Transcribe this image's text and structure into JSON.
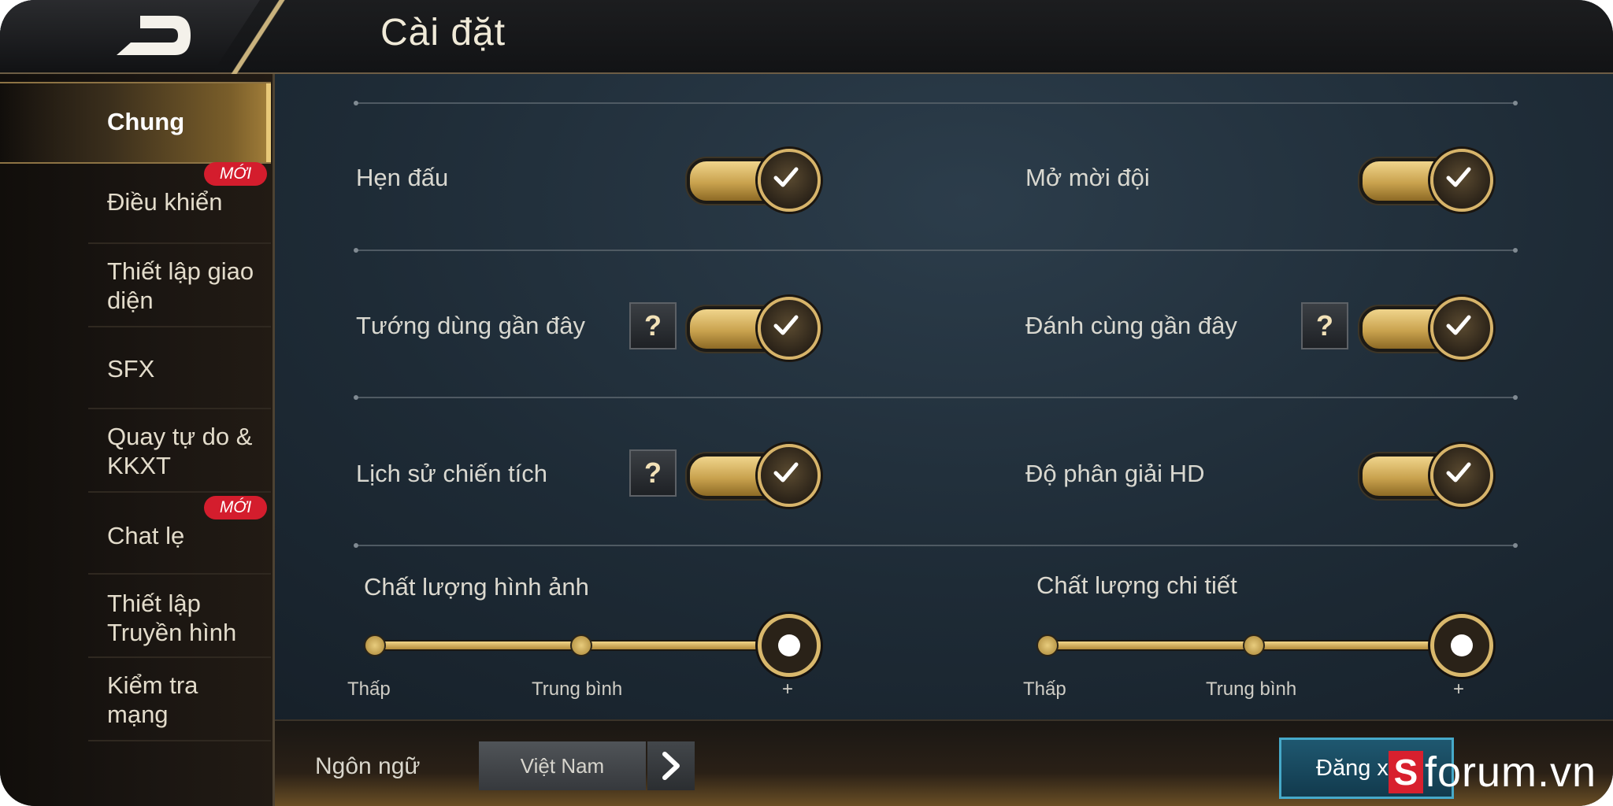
{
  "header": {
    "title": "Cài đặt",
    "back_icon": "back-arrow-icon"
  },
  "sidebar": {
    "items": [
      {
        "label": "Chung",
        "active": true
      },
      {
        "label": "Điều khiển",
        "badge": "MỚI"
      },
      {
        "label": "Thiết lập giao diện"
      },
      {
        "label": "SFX"
      },
      {
        "label": "Quay tự do & KKXT"
      },
      {
        "label": "Chat lẹ",
        "badge": "MỚI"
      },
      {
        "label": "Thiết lập Truyền hình"
      },
      {
        "label": "Kiểm tra mạng"
      }
    ]
  },
  "settings": {
    "hen_dau": {
      "label": "Hẹn đấu",
      "on": true
    },
    "mo_moi_doi": {
      "label": "Mở mời đội",
      "on": true
    },
    "tuong_dung": {
      "label": "Tướng dùng gần đây",
      "on": true,
      "help": "?"
    },
    "danh_cung": {
      "label": "Đánh cùng gần đây",
      "on": true,
      "help": "?"
    },
    "lich_su": {
      "label": "Lịch sử chiến tích",
      "on": true,
      "help": "?"
    },
    "hd": {
      "label": "Độ phân giải HD",
      "on": true
    }
  },
  "sliders": {
    "image_quality": {
      "title": "Chất lượng hình ảnh",
      "ticks": [
        "Thấp",
        "Trung bình",
        "+"
      ],
      "selected_index": 2
    },
    "detail_quality": {
      "title": "Chất lượng chi tiết",
      "ticks": [
        "Thấp",
        "Trung bình",
        "+"
      ],
      "selected_index": 2
    }
  },
  "footer": {
    "language_label": "Ngôn ngữ",
    "language_value": "Việt Nam",
    "logout_label": "Đăng xuất"
  },
  "watermark": {
    "s": "S",
    "text": "forum.vn"
  },
  "colors": {
    "accent_gold": "#d7b46a",
    "badge_red": "#d41d2d",
    "logout_blue": "#1f5870"
  }
}
